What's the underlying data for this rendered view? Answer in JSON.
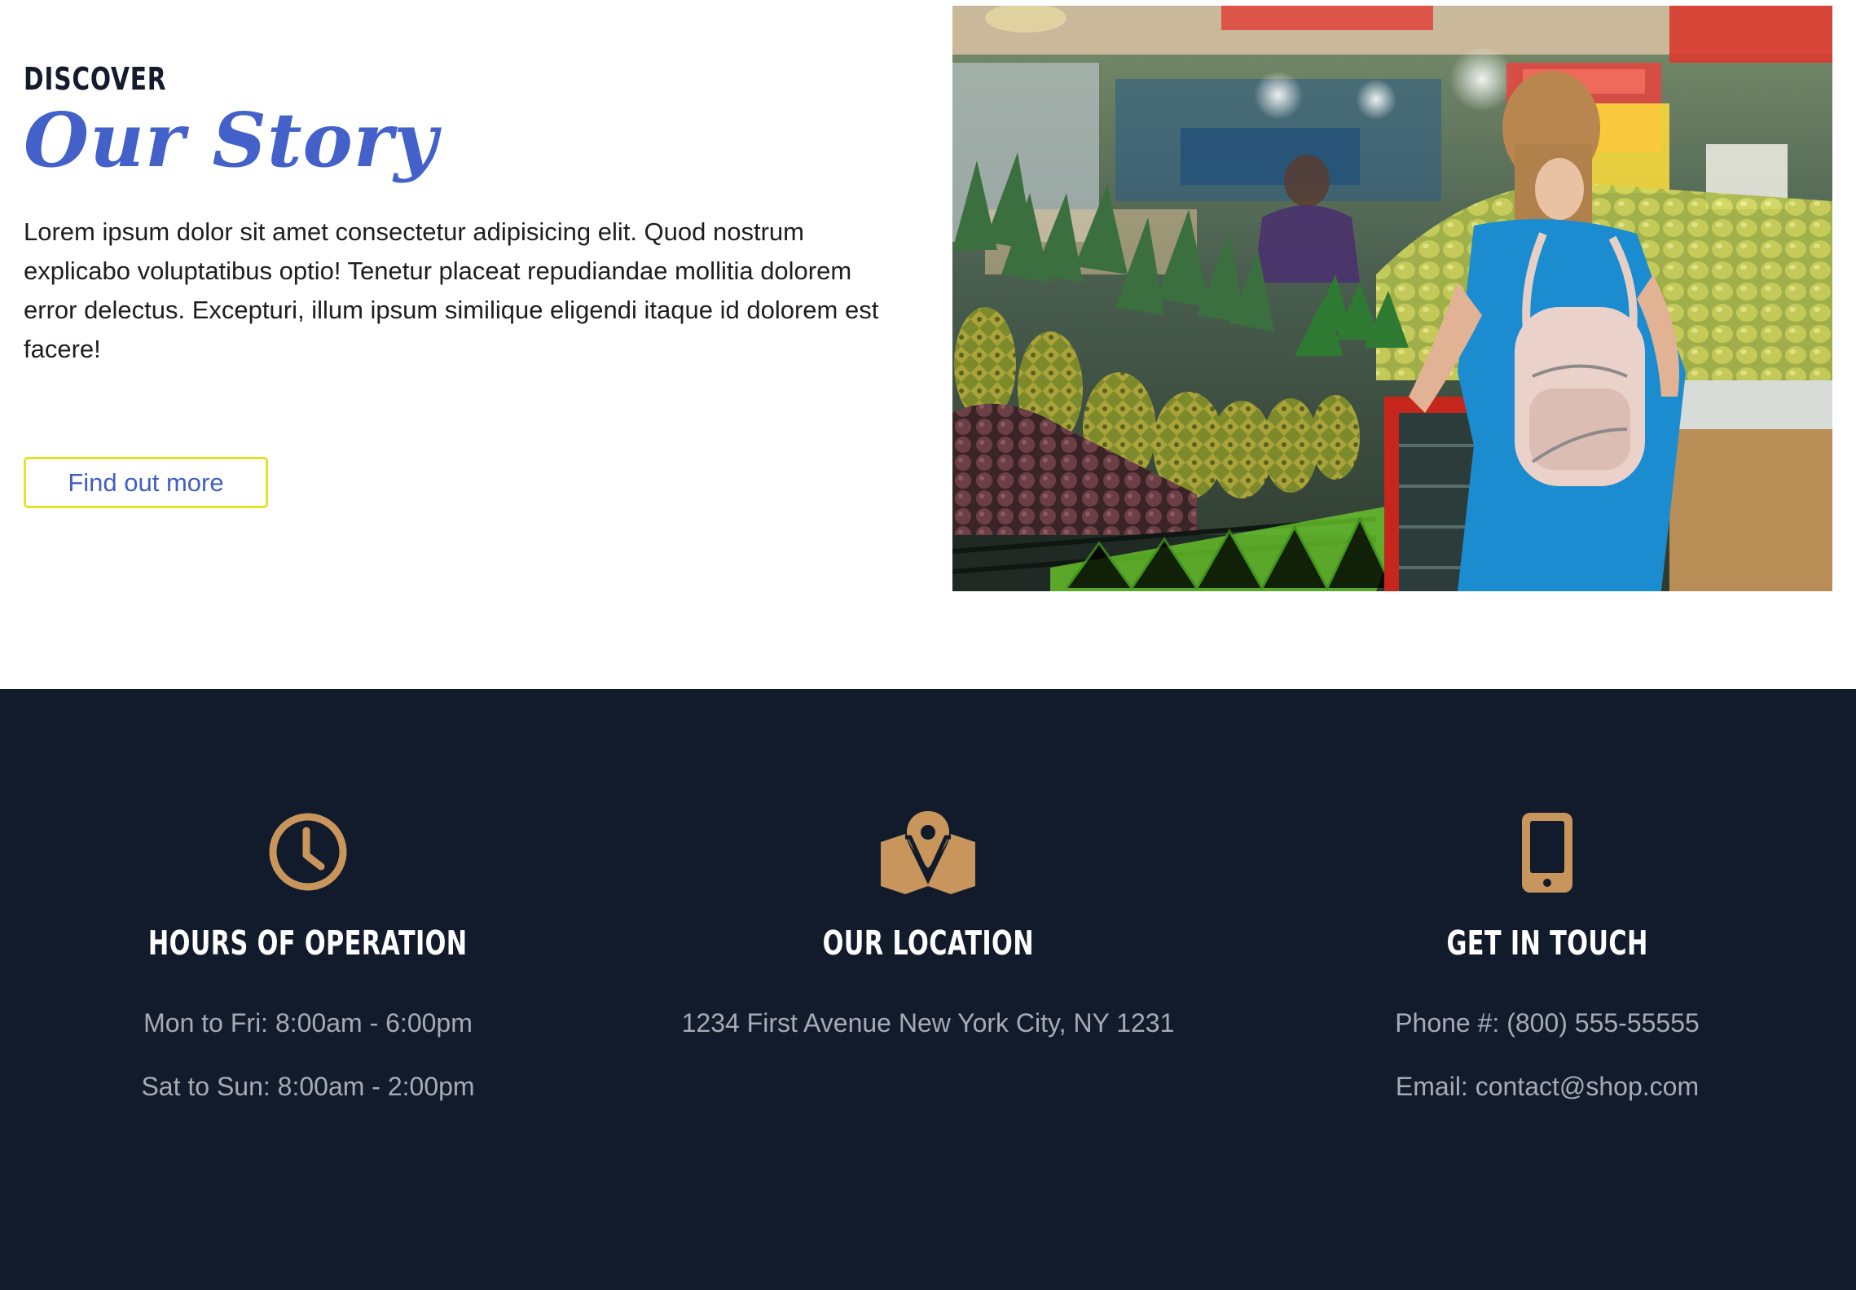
{
  "story": {
    "eyebrow": "DISCOVER",
    "title": "Our Story",
    "body": "Lorem ipsum dolor sit amet consectetur adipisicing elit. Quod nostrum explicabo voluptatibus optio! Tenetur placeat repudiandae mollitia dolorem error delectus. Excepturi, illum ipsum similique eligendi itaque id dolorem est facere!",
    "button_label": "Find out more"
  },
  "info": {
    "columns": [
      {
        "icon": "clock-icon",
        "title": "HOURS OF OPERATION",
        "lines": [
          "Mon to Fri: 8:00am - 6:00pm",
          "Sat to Sun: 8:00am - 2:00pm"
        ]
      },
      {
        "icon": "map-pin-icon",
        "title": "OUR LOCATION",
        "lines": [
          "1234 First Avenue New York City, NY 1231"
        ]
      },
      {
        "icon": "mobile-phone-icon",
        "title": "GET IN TOUCH",
        "lines": [
          "Phone #: (800) 555-55555",
          "Email: contact@shop.com"
        ]
      }
    ]
  },
  "colors": {
    "accent_blue": "#4361c9",
    "button_border": "#e4e32c",
    "footer_bg": "#121b2b",
    "icon_gold": "#c8965c",
    "footer_text": "#a6abb5"
  }
}
